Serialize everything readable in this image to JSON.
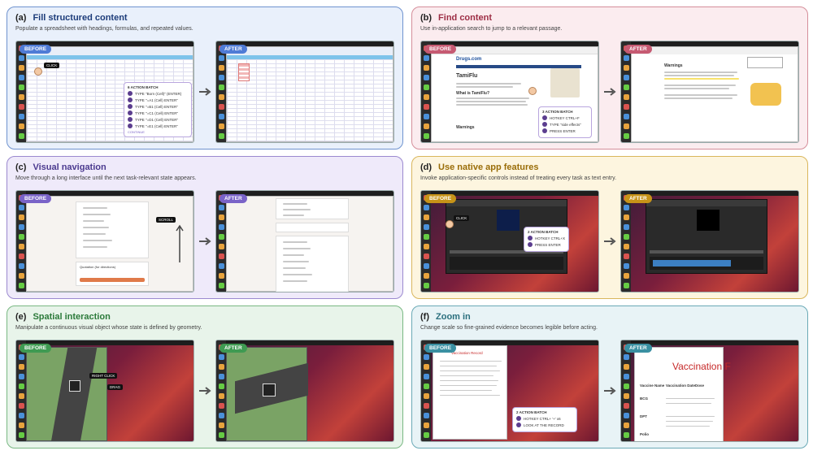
{
  "labels": {
    "before": "BEFORE",
    "after": "AFTER"
  },
  "panels": [
    {
      "id": "a",
      "letter": "(a)",
      "title": "Fill structured content",
      "desc": "Populate a spreadsheet with headings, formulas, and repeated values."
    },
    {
      "id": "b",
      "letter": "(b)",
      "title": "Find content",
      "desc": "Use in-application search to jump to a relevant passage."
    },
    {
      "id": "c",
      "letter": "(c)",
      "title": "Visual navigation",
      "desc": "Move through a long interface until the next task-relevant state appears."
    },
    {
      "id": "d",
      "letter": "(d)",
      "title": "Use native app features",
      "desc": "Invoke application-specific controls instead of treating every task as text entry."
    },
    {
      "id": "e",
      "letter": "(e)",
      "title": "Spatial interaction",
      "desc": "Manipulate a continuous visual object whose state is defined by geometry."
    },
    {
      "id": "f",
      "letter": "(f)",
      "title": "Zoom in",
      "desc": "Change scale so fine-grained evidence becomes legible before acting."
    }
  ],
  "a": {
    "click_badge": "CLICK",
    "action_title": "6 ACTION BATCH",
    "actions": [
      "TYPE \"Born (Cell)\" (ENTER)",
      "TYPE \"=A1 (Cell) ENTER\"",
      "TYPE \"=B1 (Cell) ENTER\"",
      "TYPE \"=C1 (Cell) ENTER\"",
      "TYPE \"=D1 (Cell) ENTER\"",
      "TYPE \"=E1 (Cell) ENTER\""
    ],
    "footer": "CONTINUE"
  },
  "b": {
    "site": "Drugs.com",
    "drug": "TamiFlu",
    "section1": "What is TamiFlu?",
    "section2": "Warnings",
    "action_title": "3 ACTION BATCH",
    "actions": [
      "HOTKEY CTRL+F",
      "TYPE \"side effects\"",
      "PRESS ENTER"
    ],
    "after_heading": "Warnings"
  },
  "c": {
    "scroll_badge": "SCROLL",
    "question": "Quotation (for directions)"
  },
  "d": {
    "click_badge": "CLICK",
    "action_title": "2 ACTION BATCH",
    "actions": [
      "HOTKEY CTRL+X",
      "PRESS ENTER"
    ]
  },
  "e": {
    "click_badge": "RIGHT CLICK",
    "drag_badge": "DRAG"
  },
  "f": {
    "doc_title": "Vaccination Record",
    "zoom_title": "Vaccination F",
    "col1": "Vaccine Name",
    "col2": "Vaccination Date",
    "col3": "Dose",
    "rows": [
      "BCG",
      "DPT",
      "Polio"
    ],
    "action_title": "2 ACTION BATCH",
    "actions": [
      "HOTKEY CTRL+ '+' x6",
      "LOOK AT THE RECORD"
    ]
  },
  "colors": {
    "a": "#4f7bd6",
    "b": "#c65a72",
    "c": "#7a63c8",
    "d": "#c79318",
    "e": "#3f9a52",
    "f": "#3a90a2"
  }
}
